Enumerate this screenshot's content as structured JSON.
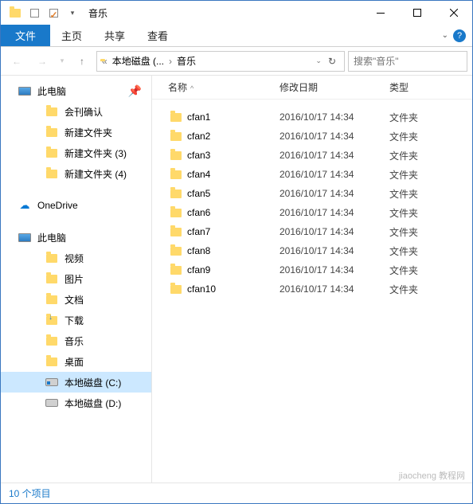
{
  "window": {
    "title": "音乐"
  },
  "ribbon": {
    "file": "文件",
    "tabs": [
      "主页",
      "共享",
      "查看"
    ]
  },
  "address": {
    "sep_left": "«",
    "crumbs": [
      "本地磁盘 (...",
      "音乐"
    ],
    "search_placeholder": "搜索\"音乐\""
  },
  "sidebar": [
    {
      "label": "此电脑",
      "icon": "pc",
      "indent": 0,
      "pin": true
    },
    {
      "label": "会刊确认",
      "icon": "folder",
      "indent": 1
    },
    {
      "label": "新建文件夹",
      "icon": "folder",
      "indent": 1
    },
    {
      "label": "新建文件夹 (3)",
      "icon": "folder",
      "indent": 1
    },
    {
      "label": "新建文件夹 (4)",
      "icon": "folder",
      "indent": 1
    },
    {
      "gap": true
    },
    {
      "label": "OneDrive",
      "icon": "onedrive",
      "indent": 0
    },
    {
      "gap": true
    },
    {
      "label": "此电脑",
      "icon": "pc",
      "indent": 0
    },
    {
      "label": "视频",
      "icon": "video",
      "indent": 1
    },
    {
      "label": "图片",
      "icon": "pictures",
      "indent": 1
    },
    {
      "label": "文档",
      "icon": "docs",
      "indent": 1
    },
    {
      "label": "下载",
      "icon": "downloads",
      "indent": 1
    },
    {
      "label": "音乐",
      "icon": "music",
      "indent": 1
    },
    {
      "label": "桌面",
      "icon": "desktop",
      "indent": 1
    },
    {
      "label": "本地磁盘 (C:)",
      "icon": "drive-c",
      "indent": 1,
      "selected": true
    },
    {
      "label": "本地磁盘 (D:)",
      "icon": "drive",
      "indent": 1
    }
  ],
  "columns": {
    "name": "名称",
    "date": "修改日期",
    "type": "类型"
  },
  "files": [
    {
      "name": "cfan1",
      "date": "2016/10/17 14:34",
      "type": "文件夹"
    },
    {
      "name": "cfan2",
      "date": "2016/10/17 14:34",
      "type": "文件夹"
    },
    {
      "name": "cfan3",
      "date": "2016/10/17 14:34",
      "type": "文件夹"
    },
    {
      "name": "cfan4",
      "date": "2016/10/17 14:34",
      "type": "文件夹"
    },
    {
      "name": "cfan5",
      "date": "2016/10/17 14:34",
      "type": "文件夹"
    },
    {
      "name": "cfan6",
      "date": "2016/10/17 14:34",
      "type": "文件夹"
    },
    {
      "name": "cfan7",
      "date": "2016/10/17 14:34",
      "type": "文件夹"
    },
    {
      "name": "cfan8",
      "date": "2016/10/17 14:34",
      "type": "文件夹"
    },
    {
      "name": "cfan9",
      "date": "2016/10/17 14:34",
      "type": "文件夹"
    },
    {
      "name": "cfan10",
      "date": "2016/10/17 14:34",
      "type": "文件夹"
    }
  ],
  "status": "10 个项目",
  "watermark": "jiaocheng 教程网"
}
